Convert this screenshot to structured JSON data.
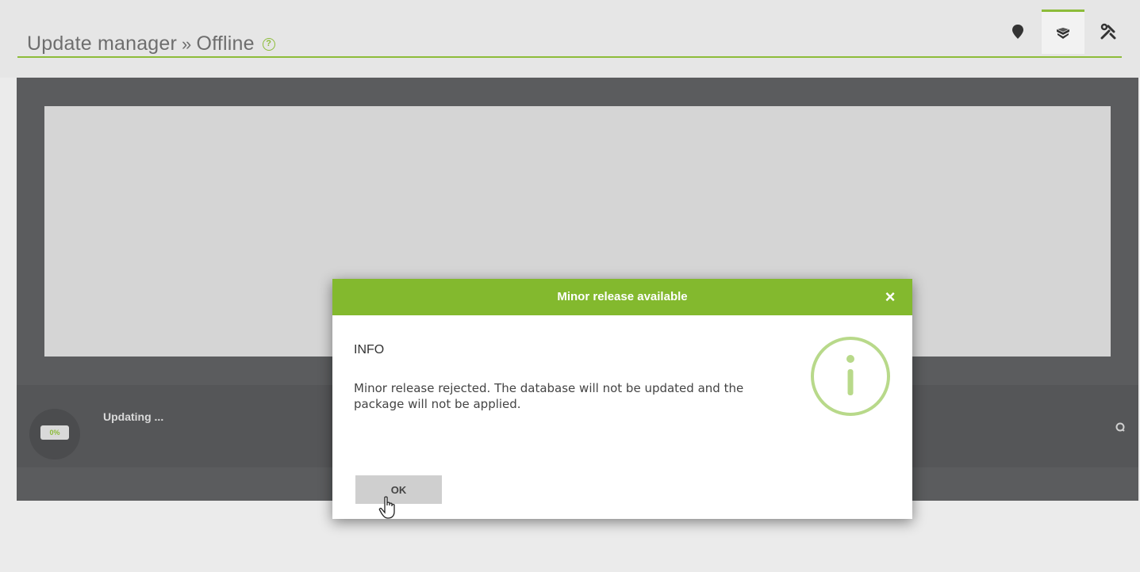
{
  "header": {
    "breadcrumb_root": "Update manager",
    "breadcrumb_separator": "»",
    "breadcrumb_current": "Offline",
    "help_icon": "question-circle-icon",
    "help_glyph": "?",
    "actions": [
      {
        "name": "location-pin-icon",
        "active": false
      },
      {
        "name": "package-box-icon",
        "active": true
      },
      {
        "name": "tools-icon",
        "active": false
      }
    ]
  },
  "status": {
    "progress_label": "0%",
    "progress_value": 0,
    "status_text": "Updating ...",
    "refresh_icon": "refresh-icon"
  },
  "dialog": {
    "title": "Minor release available",
    "close_glyph": "×",
    "heading": "INFO",
    "message": "Minor release rejected. The database will not be updated and the package will not be applied.",
    "icon": "info-circle-icon",
    "ok_label": "OK"
  },
  "colors": {
    "accent": "#83b92e",
    "panel": "#5b5c5e",
    "preview": "#d5d5d5"
  }
}
